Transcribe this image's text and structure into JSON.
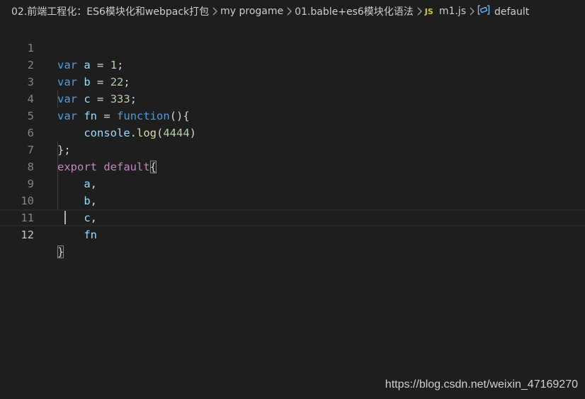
{
  "breadcrumb": {
    "items": [
      "02.前端工程化：ES6模块化和webpack打包",
      "my progame",
      "01.bable+es6模块化语法"
    ],
    "file_badge": "JS",
    "file_name": "m1.js",
    "symbol_icon": "symbol-variable-icon",
    "symbol_name": "default"
  },
  "editor": {
    "line_numbers": [
      "1",
      "2",
      "3",
      "4",
      "5",
      "6",
      "7",
      "8",
      "9",
      "10",
      "11",
      "12"
    ],
    "current_line": 12,
    "tokens": {
      "l1": [
        "var",
        "a",
        "=",
        "1",
        ";"
      ],
      "l2": [
        "var",
        "b",
        "=",
        "22",
        ";"
      ],
      "l3": [
        "var",
        "c",
        "=",
        "333",
        ";"
      ],
      "l4": [
        "var",
        "fn",
        "=",
        "function",
        "(){"
      ],
      "l5": [
        "console",
        ".",
        "log",
        "(",
        "4444",
        ")"
      ],
      "l6": [
        "};"
      ],
      "l7": [
        "export",
        "default",
        "{"
      ],
      "l8": [
        "a",
        ","
      ],
      "l9": [
        "b",
        ","
      ],
      "l10": [
        "c",
        ","
      ],
      "l11": [
        "fn"
      ],
      "l12": [
        "}"
      ]
    }
  },
  "colors": {
    "background": "#1e1e1e",
    "keyword": "#569cd6",
    "control_keyword": "#c586c0",
    "variable": "#9cdcfe",
    "number": "#b5cea8",
    "function": "#dcdcaa",
    "line_number": "#858585"
  },
  "watermark": "https://blog.csdn.net/weixin_47169270"
}
